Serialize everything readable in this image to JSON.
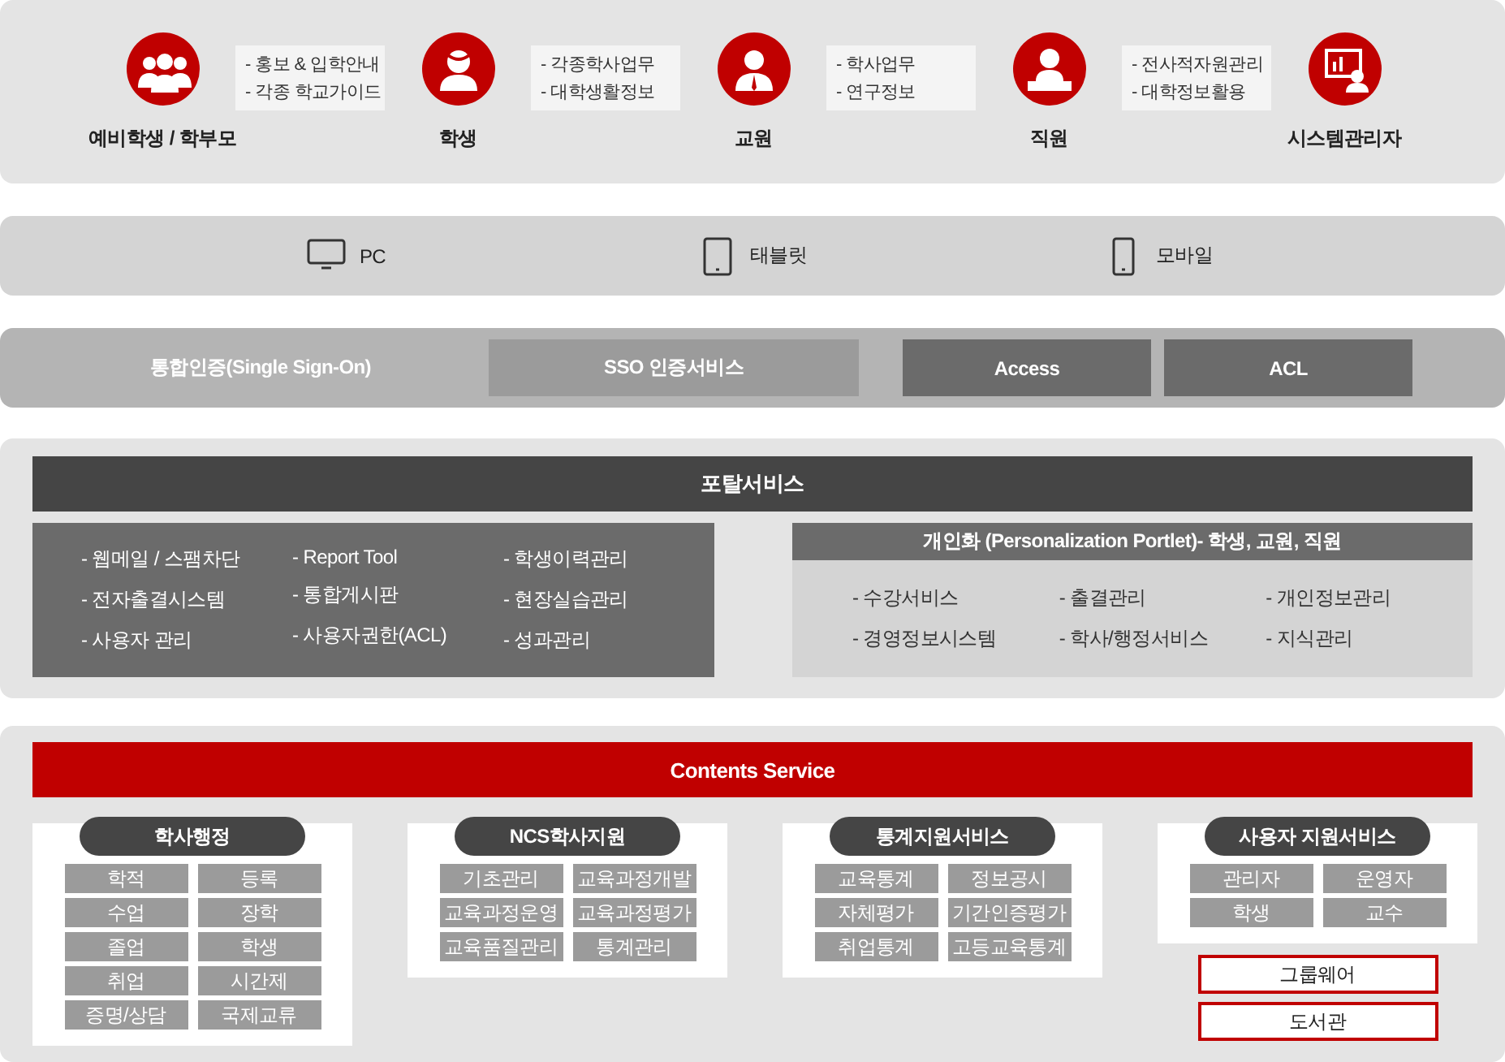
{
  "users": [
    {
      "label": "예비학생 / 학부모",
      "notes": [
        "- 홍보 & 입학안내",
        "- 각종 학교가이드"
      ]
    },
    {
      "label": "학생",
      "notes": [
        "- 각종학사업무",
        "- 대학생활정보"
      ]
    },
    {
      "label": "교원",
      "notes": [
        "- 학사업무",
        "- 연구정보"
      ]
    },
    {
      "label": "직원",
      "notes": [
        "- 전사적자원관리",
        "- 대학정보활용"
      ]
    },
    {
      "label": "시스템관리자"
    }
  ],
  "devices": [
    {
      "label": "PC"
    },
    {
      "label": "태블릿"
    },
    {
      "label": "모바일"
    }
  ],
  "sso": {
    "label": "통합인증(Single Sign-On)",
    "items": [
      {
        "label": "SSO 인증서비스",
        "kind": "light"
      },
      {
        "label": "Access",
        "kind": "dark"
      },
      {
        "label": "ACL",
        "kind": "dark"
      }
    ]
  },
  "portal": {
    "title": "포탈서비스",
    "columns": [
      [
        "- 웹메일 / 스팸차단",
        "- 전자출결시스템",
        "- 사용자 관리"
      ],
      [
        "- Report Tool",
        "- 통합게시판",
        "- 사용자권한(ACL)"
      ],
      [
        "- 학생이력관리",
        "- 현장실습관리",
        "- 성과관리"
      ]
    ],
    "personalization": {
      "title": "개인화 (Personalization Portlet)- 학생, 교원, 직원",
      "columns": [
        [
          "- 수강서비스",
          "- 경영정보시스템"
        ],
        [
          "- 출결관리",
          "- 학사/행정서비스"
        ],
        [
          "- 개인정보관리",
          "- 지식관리"
        ]
      ]
    }
  },
  "contents": {
    "title": "Contents Service",
    "groups": [
      {
        "title": "학사행정",
        "items": [
          "학적",
          "등록",
          "수업",
          "장학",
          "졸업",
          "학생",
          "취업",
          "시간제",
          "증명/상담",
          "국제교류"
        ]
      },
      {
        "title": "NCS학사지원",
        "items": [
          "기초관리",
          "교육과정개발",
          "교육과정운영",
          "교육과정평가",
          "교육품질관리",
          "통계관리"
        ]
      },
      {
        "title": "통계지원서비스",
        "items": [
          "교육통계",
          "정보공시",
          "자체평가",
          "기간인증평가",
          "취업통계",
          "고등교육통계"
        ]
      },
      {
        "title": "사용자 지원서비스",
        "items": [
          "관리자",
          "운영자",
          "학생",
          "교수"
        ]
      }
    ],
    "extras": [
      "그룹웨어",
      "도서관"
    ]
  }
}
